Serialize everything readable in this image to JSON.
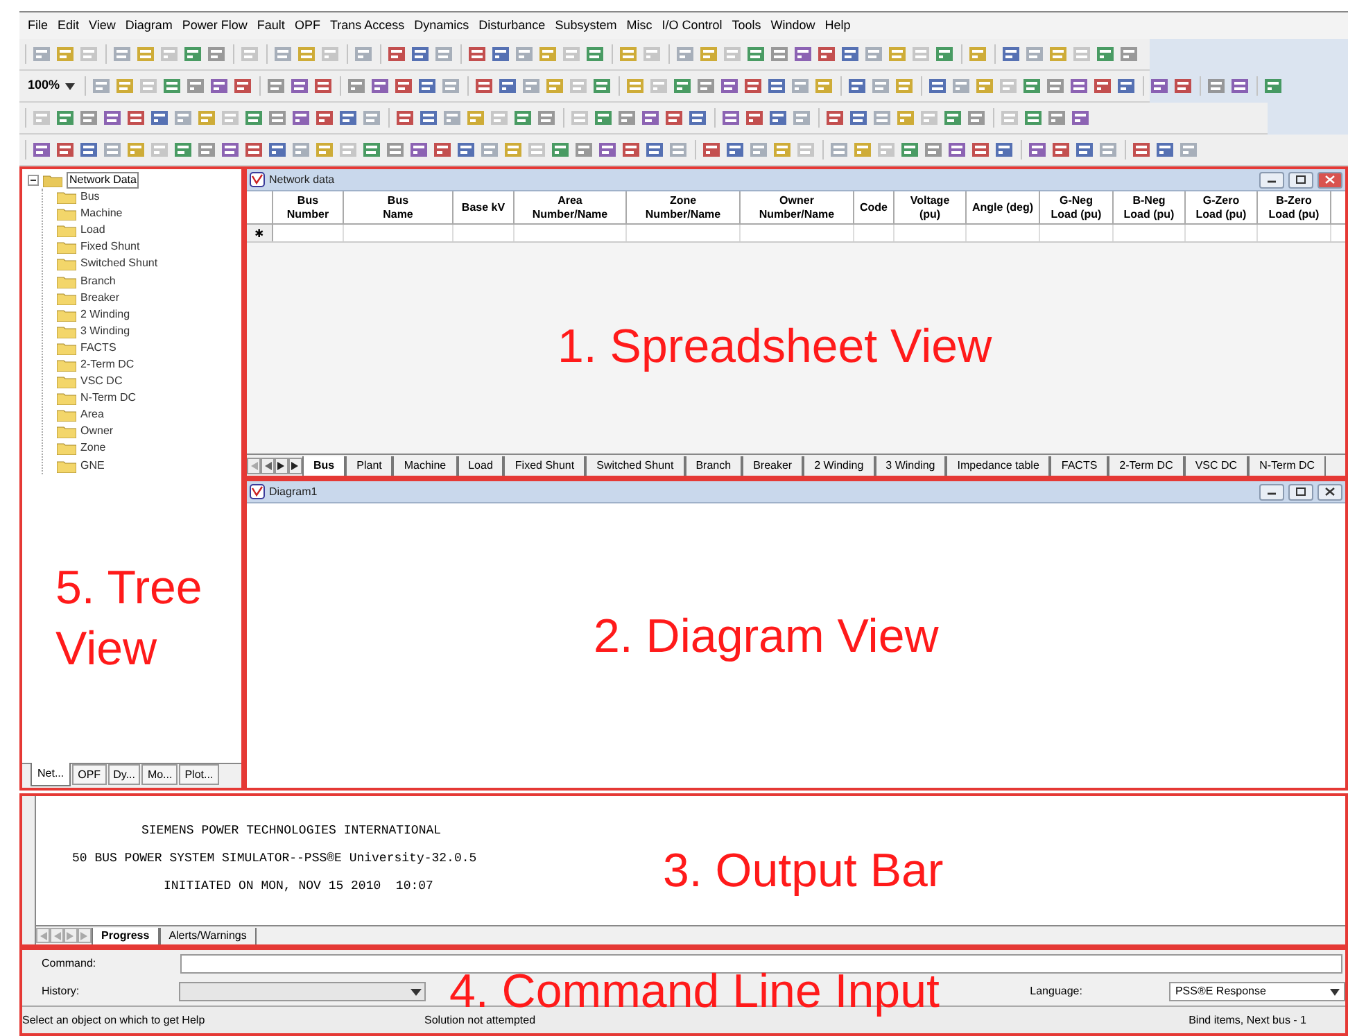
{
  "menu": [
    "File",
    "Edit",
    "View",
    "Diagram",
    "Power Flow",
    "Fault",
    "OPF",
    "Trans Access",
    "Dynamics",
    "Disturbance",
    "Subsystem",
    "Misc",
    "I/O Control",
    "Tools",
    "Window",
    "Help"
  ],
  "zoom": {
    "value": "100%"
  },
  "tree": {
    "root": "Network Data",
    "expanded": true,
    "children": [
      "Bus",
      "Machine",
      "Load",
      "Fixed Shunt",
      "Switched Shunt",
      "Branch",
      "Breaker",
      "2 Winding",
      "3 Winding",
      "FACTS",
      "2-Term DC",
      "VSC DC",
      "N-Term DC",
      "Area",
      "Owner",
      "Zone",
      "GNE"
    ],
    "tabs": [
      {
        "label": "Net...",
        "selected": true
      },
      {
        "label": "OPF",
        "selected": false
      },
      {
        "label": "Dy...",
        "selected": false
      },
      {
        "label": "Mo...",
        "selected": false
      },
      {
        "label": "Plot...",
        "selected": false
      }
    ]
  },
  "spreadsheet": {
    "title": "Network data",
    "row_marker": "✱",
    "columns": [
      "Bus\nNumber",
      "Bus\nName",
      "Base kV",
      "Area\nNumber/Name",
      "Zone\nNumber/Name",
      "Owner\nNumber/Name",
      "Code",
      "Voltage\n(pu)",
      "Angle (deg)",
      "G-Neg\nLoad (pu)",
      "B-Neg\nLoad (pu)",
      "G-Zero\nLoad (pu)",
      "B-Zero\nLoad (pu)"
    ],
    "tabs": [
      {
        "label": "Bus",
        "selected": true
      },
      {
        "label": "Plant",
        "selected": false
      },
      {
        "label": "Machine",
        "selected": false
      },
      {
        "label": "Load",
        "selected": false
      },
      {
        "label": "Fixed Shunt",
        "selected": false
      },
      {
        "label": "Switched Shunt",
        "selected": false
      },
      {
        "label": "Branch",
        "selected": false
      },
      {
        "label": "Breaker",
        "selected": false
      },
      {
        "label": "2 Winding",
        "selected": false
      },
      {
        "label": "3 Winding",
        "selected": false
      },
      {
        "label": "Impedance table",
        "selected": false
      },
      {
        "label": "FACTS",
        "selected": false
      },
      {
        "label": "2-Term DC",
        "selected": false
      },
      {
        "label": "VSC DC",
        "selected": false
      },
      {
        "label": "N-Term DC",
        "selected": false
      }
    ]
  },
  "diagram": {
    "title": "Diagram1"
  },
  "output": {
    "lines": [
      "SIEMENS POWER TECHNOLOGIES INTERNATIONAL",
      "50 BUS POWER SYSTEM SIMULATOR--PSS®E University-32.0.5",
      "INITIATED ON MON, NOV 15 2010  10:07"
    ],
    "tabs": [
      {
        "label": "Progress",
        "selected": true
      },
      {
        "label": "Alerts/Warnings",
        "selected": false
      }
    ]
  },
  "command": {
    "command_label": "Command:",
    "history_label": "History:",
    "language_label": "Language:",
    "language_value": "PSS®E Response"
  },
  "status_bar": [
    "Select an object on which to get Help",
    "Solution not attempted",
    "Bind items, Next bus - 1"
  ],
  "annotations": [
    "1. Spreadsheet View",
    "2. Diagram View",
    "3. Output Bar",
    "4. Command Line Input",
    "5. Tree View"
  ]
}
